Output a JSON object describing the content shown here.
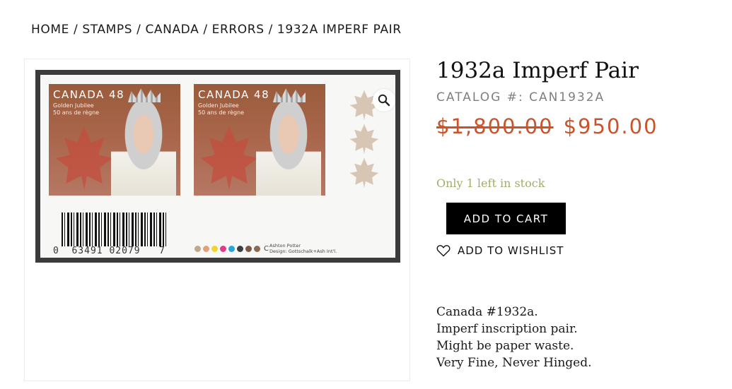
{
  "breadcrumb": {
    "items": [
      "HOME",
      "STAMPS",
      "CANADA",
      "ERRORS",
      "1932A IMPERF PAIR"
    ],
    "separator": "/"
  },
  "gallery": {
    "zoom_icon": "magnifier-icon",
    "stamp": {
      "title": "CANADA 48",
      "subtitle_line1": "Golden Jubilee",
      "subtitle_line2": "50 ans de règne"
    },
    "barcode_digits": "0  63491 02079   7",
    "dot_colors": [
      "#bfa98a",
      "#e5a07a",
      "#f4d232",
      "#e23b8c",
      "#29a4d9",
      "#3e3e3e",
      "#7a5a46",
      "#8c6b55"
    ],
    "dot_suffix": "C",
    "credits_line1": "Ashton Potter",
    "credits_line2": "Design: Gottschalk+Ash Int'l."
  },
  "product": {
    "title": "1932a Imperf Pair",
    "catalog_label": "CATALOG #:",
    "catalog_number": "CAN1932A",
    "old_price": "$1,800.00",
    "new_price": "$950.00",
    "stock_text": "Only 1 left in stock",
    "add_to_cart_label": "ADD TO CART",
    "wishlist_label": "ADD TO WISHLIST",
    "description": [
      "Canada #1932a.",
      "Imperf inscription pair.",
      "Might be paper waste.",
      "Very Fine, Never Hinged."
    ]
  },
  "colors": {
    "price": "#c9542c",
    "stock": "#a6ad6b",
    "catalog": "#7f7f7f",
    "button_bg": "#000000"
  }
}
